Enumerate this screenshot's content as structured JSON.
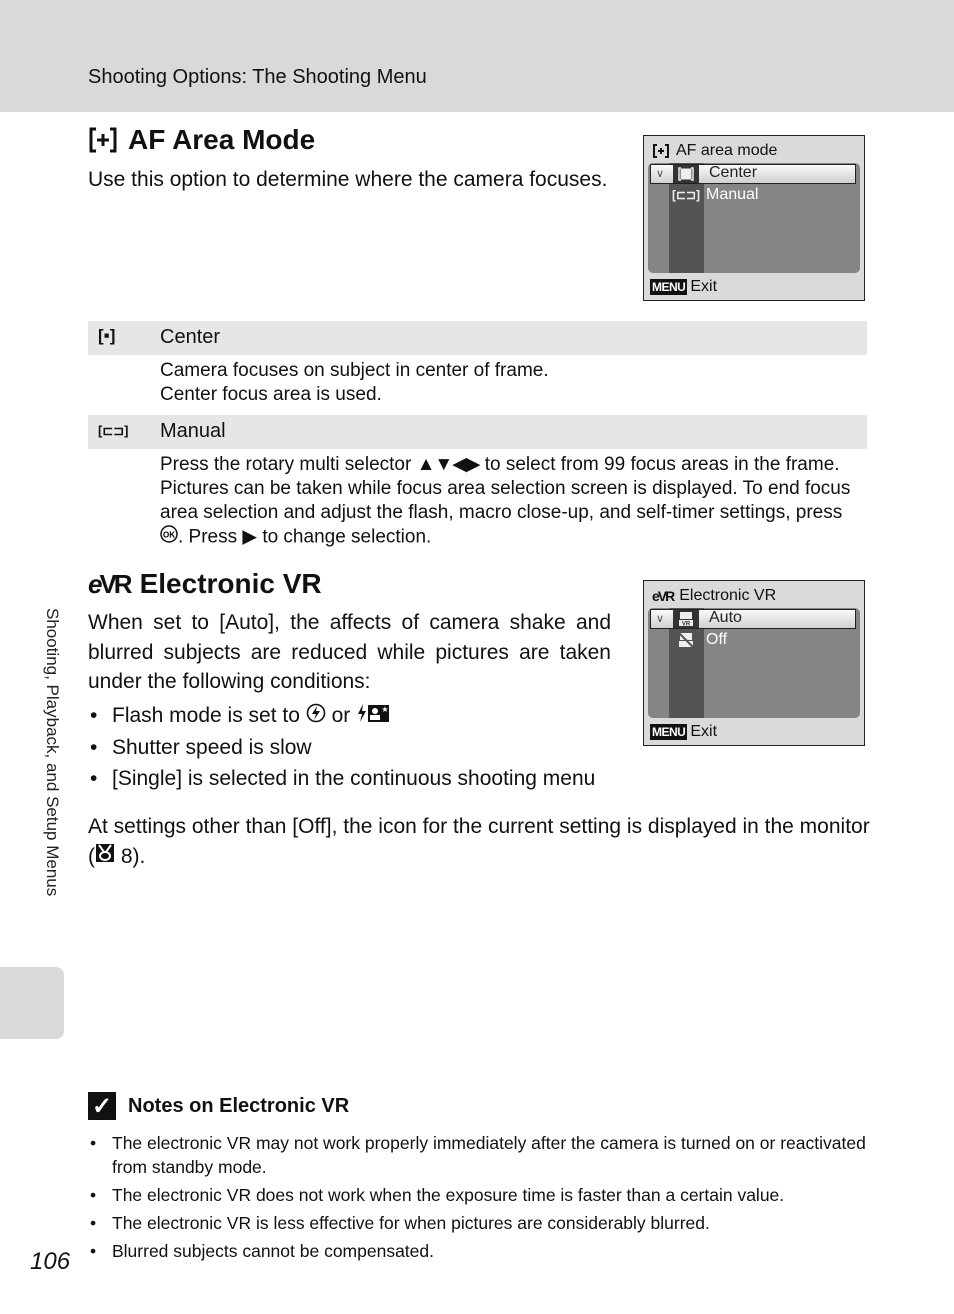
{
  "header": {
    "title": "Shooting Options: The Shooting Menu"
  },
  "side_tab": {
    "label": "Shooting, Playback, and Setup Menus"
  },
  "af_area": {
    "icon": "af-area-bracket-plus-icon",
    "heading": "AF Area Mode",
    "intro": "Use this option to determine where the camera focuses.",
    "screen": {
      "title": "AF area mode",
      "options": [
        {
          "icon": "center-focus-icon",
          "label": "Center",
          "selected": true
        },
        {
          "icon": "manual-focus-icon",
          "label": "Manual",
          "selected": false
        }
      ],
      "menu_key": "MENU",
      "footer": "Exit"
    },
    "options": [
      {
        "icon_glyph": "[▪]",
        "label": "Center",
        "desc": [
          "Camera focuses on subject in center of frame.",
          "Center focus area is used."
        ]
      },
      {
        "icon_glyph": "[⊏⊐]",
        "label": "Manual",
        "desc_parts": {
          "a": "Press the rotary multi selector",
          "arrows": "▲▼◀▶",
          "b": "to select from 99 focus areas in the frame. Pictures can be taken while focus area selection screen is displayed. To end focus area selection and adjust the flash, macro close-up, and self-timer settings, press",
          "ok": "OK",
          "c": ". Press",
          "right": "▶",
          "d": "to change selection."
        }
      }
    ]
  },
  "vr": {
    "icon": "electronic-vr-icon",
    "heading": "Electronic VR",
    "intro": "When set to [Auto], the affects of camera shake and blurred subjects are reduced while pictures are taken under the following conditions:",
    "bullets": {
      "flash_a": "Flash mode is set to",
      "flash_or": "or",
      "b2": "Shutter speed is slow",
      "b3": "[Single] is selected in the continuous shooting menu"
    },
    "screen": {
      "title": "Electronic VR",
      "options": [
        {
          "icon": "vr-auto-icon",
          "label": "Auto",
          "selected": true
        },
        {
          "icon": "vr-off-icon",
          "label": "Off",
          "selected": false
        }
      ],
      "menu_key": "MENU",
      "footer": "Exit"
    },
    "after_a": "At settings other than [Off], the icon for the current setting is displayed in the monitor (",
    "after_ref": "8",
    "after_b": ")."
  },
  "notes": {
    "title": "Notes on Electronic VR",
    "items": [
      "The electronic VR may not work properly immediately after the camera is turned on or reactivated from standby mode.",
      "The electronic VR does not work when the exposure time is faster than a certain value.",
      "The electronic VR is less effective for when pictures are considerably blurred.",
      "Blurred subjects cannot be compensated."
    ]
  },
  "page_number": "106"
}
